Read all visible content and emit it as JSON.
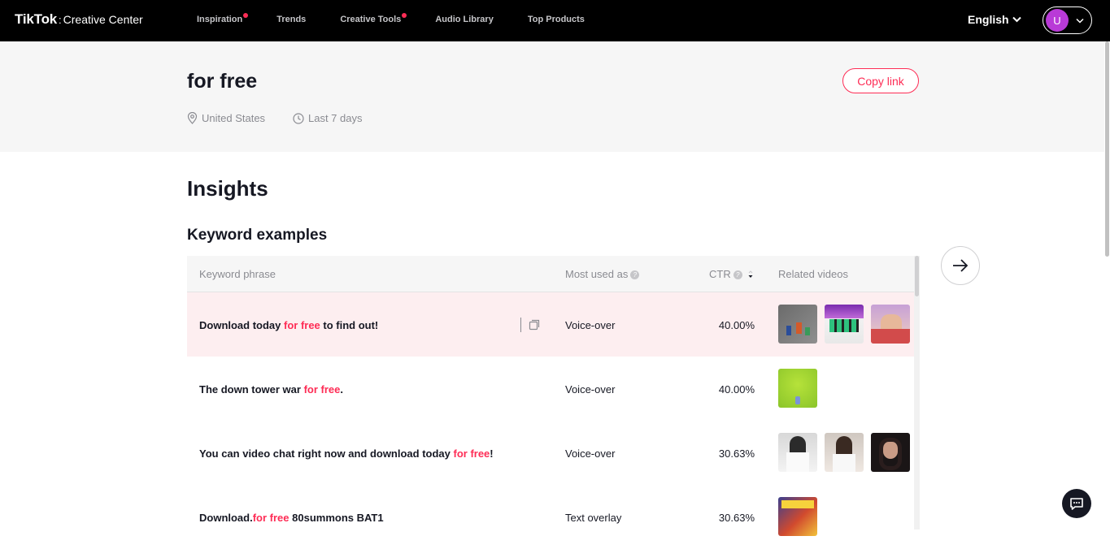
{
  "nav": {
    "brand": "TikTok",
    "separator": ":",
    "product": "Creative Center",
    "items": [
      {
        "label": "Inspiration",
        "dot": true
      },
      {
        "label": "Trends",
        "dot": false
      },
      {
        "label": "Creative Tools",
        "dot": true
      },
      {
        "label": "Audio Library",
        "dot": false
      },
      {
        "label": "Top Products",
        "dot": false
      }
    ],
    "language": "English",
    "avatar_initial": "U"
  },
  "header": {
    "title": "for free",
    "copy_link": "Copy link",
    "location": "United States",
    "period": "Last 7 days"
  },
  "insights": {
    "title": "Insights",
    "keyword_examples_title": "Keyword examples",
    "columns": {
      "phrase": "Keyword phrase",
      "used_as": "Most used as",
      "ctr": "CTR",
      "related": "Related videos"
    },
    "rows": [
      {
        "before": "Download today ",
        "keyword": "for free",
        "after": " to find out!",
        "used_as": "Voice-over",
        "ctr": "40.00%",
        "videos": 3
      },
      {
        "before": "The down tower war ",
        "keyword": "for free",
        "after": ".",
        "used_as": "Voice-over",
        "ctr": "40.00%",
        "videos": 1
      },
      {
        "before": "You can video chat right now and download today ",
        "keyword": "for free",
        "after": "!",
        "used_as": "Voice-over",
        "ctr": "30.63%",
        "videos": 3
      },
      {
        "before": "Download.",
        "keyword": "for free",
        "after": " 80summons BAT1",
        "used_as": "Text overlay",
        "ctr": "30.63%",
        "videos": 1
      }
    ]
  },
  "colors": {
    "accent": "#fe2c55",
    "nav_bg": "#000000",
    "row_highlight": "#fdeef0"
  }
}
